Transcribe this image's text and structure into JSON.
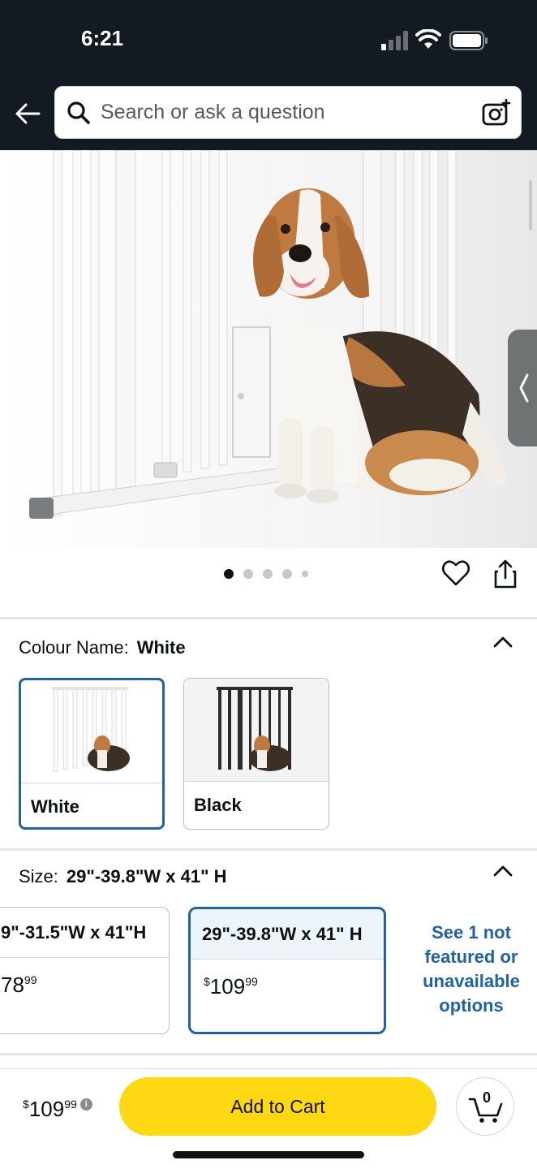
{
  "status_bar": {
    "time": "6:21"
  },
  "search": {
    "placeholder": "Search or ask a question"
  },
  "gallery": {
    "image_count": 5,
    "active_index": 0
  },
  "colour": {
    "label": "Colour Name:",
    "selected": "White",
    "options": [
      {
        "label": "White",
        "selected": true
      },
      {
        "label": "Black",
        "selected": false
      }
    ]
  },
  "size": {
    "label": "Size:",
    "selected": "29\"-39.8\"W x 41\" H",
    "options": [
      {
        "title": "9\"-31.5\"W x 41\"H",
        "price_whole": "78",
        "price_fraction": "99",
        "selected": false
      },
      {
        "title": "29\"-39.8\"W x 41\" H",
        "price_symbol": "$",
        "price_whole": "109",
        "price_fraction": "99",
        "selected": true
      }
    ],
    "see_more": "See 1 not featured or unavailable options"
  },
  "bottom_bar": {
    "price_symbol": "$",
    "price_whole": "109",
    "price_fraction": "99",
    "info_icon": "i",
    "add_to_cart": "Add to Cart",
    "cart_count": "0"
  },
  "colors": {
    "header_bg": "#131a22",
    "accent_blue": "#2162a1",
    "add_to_cart_yellow": "#ffd814"
  }
}
